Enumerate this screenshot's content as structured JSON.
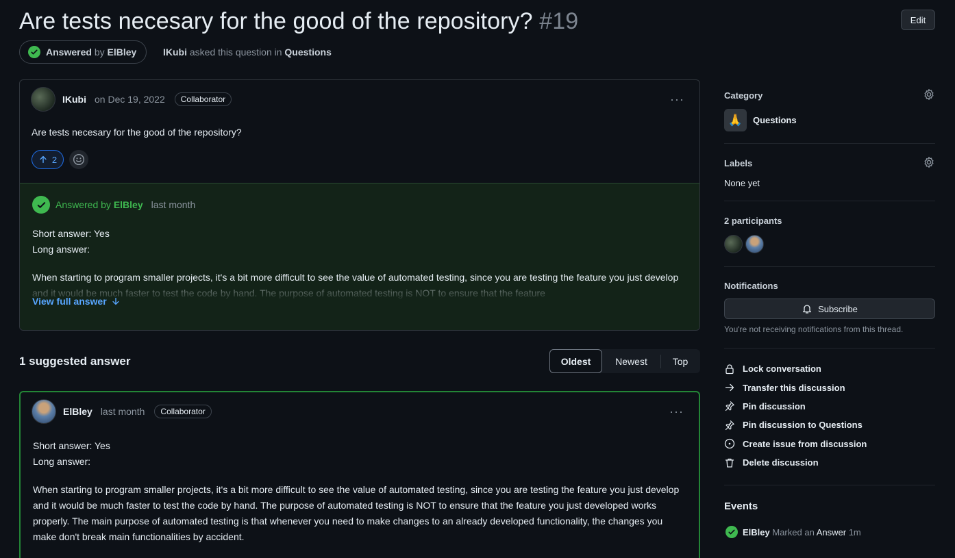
{
  "header": {
    "title": "Are tests necesary for the good of the repository?",
    "number": "#19",
    "edit_label": "Edit",
    "answered_label": "Answered",
    "answered_by_word": "by",
    "answered_by_user": "ElBley",
    "asker": "IKubi",
    "asked_text": "asked this question in",
    "category": "Questions"
  },
  "question": {
    "author": "IKubi",
    "date": "on Dec 19, 2022",
    "role": "Collaborator",
    "more": "···",
    "body": "Are tests necesary for the good of the repository?",
    "upvotes": "2"
  },
  "accepted": {
    "label": "Answered by",
    "user": "ElBley",
    "when": "last month",
    "line1": "Short answer: Yes",
    "line2": "Long answer:",
    "preview": "When starting to program smaller projects, it's a bit more difficult to see the value of automated testing, since you are testing the feature you just develop and it would be much faster to test the code by hand. The purpose of automated testing is NOT to ensure that the feature",
    "view_full": "View full answer"
  },
  "answers_section": {
    "title": "1 suggested answer",
    "sort_options": [
      "Oldest",
      "Newest",
      "Top"
    ],
    "selected_sort": "Oldest"
  },
  "answer": {
    "author": "ElBley",
    "when": "last month",
    "role": "Collaborator",
    "more": "···",
    "line1": "Short answer: Yes",
    "line2": "Long answer:",
    "paragraph": "When starting to program smaller projects, it's a bit more difficult to see the value of automated testing, since you are testing the feature you just develop and it would be much faster to test the code by hand. The purpose of automated testing is NOT to ensure that the feature you just developed works properly. The main purpose of automated testing is that whenever you need to make changes to an already developed functionality, the changes you make don't break main functionalities by accident."
  },
  "sidebar": {
    "category_label": "Category",
    "category_emoji": "🙏",
    "category_name": "Questions",
    "labels_label": "Labels",
    "labels_value": "None yet",
    "participants_label": "2 participants",
    "notifications_label": "Notifications",
    "subscribe_label": "Subscribe",
    "subscribe_note": "You're not receiving notifications from this thread.",
    "actions": [
      {
        "label": "Lock conversation",
        "icon": "lock-icon"
      },
      {
        "label": "Transfer this discussion",
        "icon": "arrow-right-icon"
      },
      {
        "label": "Pin discussion",
        "icon": "pin-icon"
      },
      {
        "label": "Pin discussion to Questions",
        "icon": "pin-icon"
      },
      {
        "label": "Create issue from discussion",
        "icon": "issue-opened-icon"
      },
      {
        "label": "Delete discussion",
        "icon": "trash-icon"
      }
    ],
    "events_label": "Events",
    "event_user": "ElBley",
    "event_text": "Marked an",
    "event_object": "Answer",
    "event_time": "1m"
  },
  "colors": {
    "background": "#0d1117",
    "accent_green": "#3fb950",
    "accent_blue": "#58a6ff",
    "border": "#30363d"
  }
}
